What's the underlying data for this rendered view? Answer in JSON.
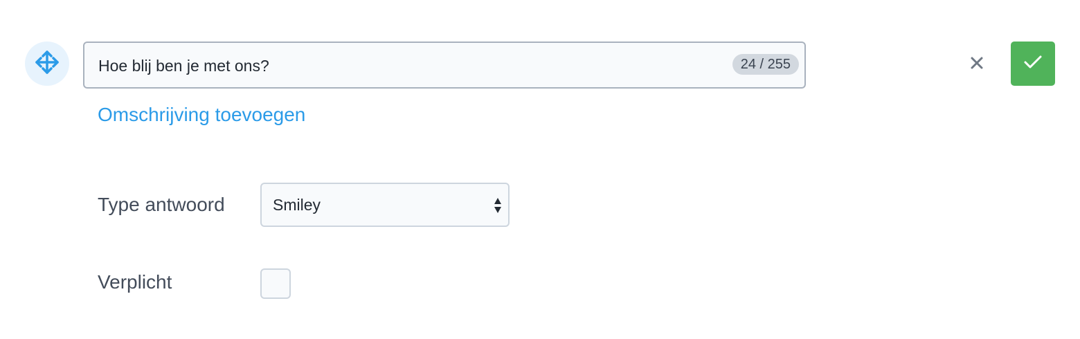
{
  "question": {
    "value": "Hoe blij ben je met ons?",
    "counter": "24 / 255"
  },
  "icons": {
    "drag": "move-arrows-icon",
    "cancel": "close-icon",
    "confirm": "checkmark-icon",
    "select": "sort-arrows-icon"
  },
  "links": {
    "add_description": "Omschrijving toevoegen"
  },
  "answer_type": {
    "label": "Type antwoord",
    "selected": "Smiley"
  },
  "required": {
    "label": "Verplicht",
    "checked": false
  },
  "colors": {
    "accent_blue": "#2b9be8",
    "confirm_green": "#50b35a",
    "drag_bg": "#e7f3fd"
  }
}
